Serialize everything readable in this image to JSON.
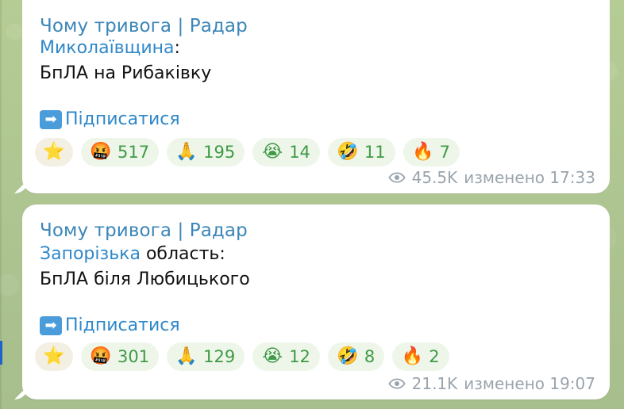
{
  "messages": [
    {
      "channel": "Чому тривога | Радар",
      "region": "Миколаївщина",
      "region_suffix": ":",
      "body": "БпЛА на Рибаківку",
      "subscribe": "Підписатися",
      "reactions": [
        {
          "icon": "star",
          "emoji": "⭐",
          "count": ""
        },
        {
          "icon": "angry-face",
          "emoji": "🤬",
          "count": "517"
        },
        {
          "icon": "pray",
          "emoji": "🙏",
          "count": "195"
        },
        {
          "icon": "crying-face",
          "emoji": "😭",
          "count": "14"
        },
        {
          "icon": "laughing-face",
          "emoji": "🤣",
          "count": "11"
        },
        {
          "icon": "fire",
          "emoji": "🔥",
          "count": "7"
        }
      ],
      "views": "45.5K",
      "edited": "изменено 17:33"
    },
    {
      "channel": "Чому тривога | Радар",
      "region": "Запорізька",
      "region_suffix": " область:",
      "body": "БпЛА біля Любицького",
      "subscribe": "Підписатися",
      "reactions": [
        {
          "icon": "star",
          "emoji": "⭐",
          "count": ""
        },
        {
          "icon": "angry-face",
          "emoji": "🤬",
          "count": "301"
        },
        {
          "icon": "pray",
          "emoji": "🙏",
          "count": "129"
        },
        {
          "icon": "crying-face",
          "emoji": "😭",
          "count": "12"
        },
        {
          "icon": "laughing-face",
          "emoji": "🤣",
          "count": "8"
        },
        {
          "icon": "fire",
          "emoji": "🔥",
          "count": "2"
        }
      ],
      "views": "21.1K",
      "edited": "изменено 19:07"
    }
  ],
  "icons": {
    "subscribe_arrow": "➡",
    "views": "eye-icon"
  },
  "colors": {
    "background": "#a9c18f",
    "bubble": "#ffffff",
    "link": "#2f88c9",
    "reaction_bg": "#eef6ea",
    "reaction_text": "#3f9a46",
    "meta": "#9aa4ad"
  }
}
